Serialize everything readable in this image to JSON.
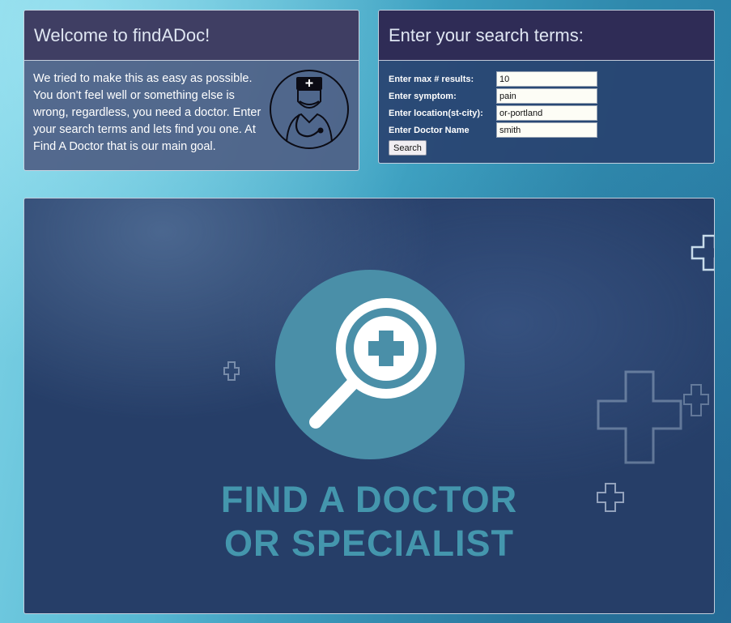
{
  "welcome": {
    "title": "Welcome to findADoc!",
    "body": "We tried to make this as easy as possible. You don't feel well or something else is wrong, regardless, you need a doctor. Enter your search terms and lets find you one. At Find A Doctor that is our main goal."
  },
  "search": {
    "title": "Enter your search terms:",
    "fields": [
      {
        "label": "Enter max # results:",
        "value": "10"
      },
      {
        "label": "Enter symptom:",
        "value": "pain"
      },
      {
        "label": "Enter location(st-city):",
        "value": "or-portland"
      },
      {
        "label": "Enter Doctor Name",
        "value": "smith"
      }
    ],
    "button": "Search"
  },
  "hero": {
    "line1": "FIND A DOCTOR",
    "line2": "OR SPECIALIST"
  },
  "colors": {
    "accent": "#4496ad",
    "panel_dark": "#263e68"
  }
}
